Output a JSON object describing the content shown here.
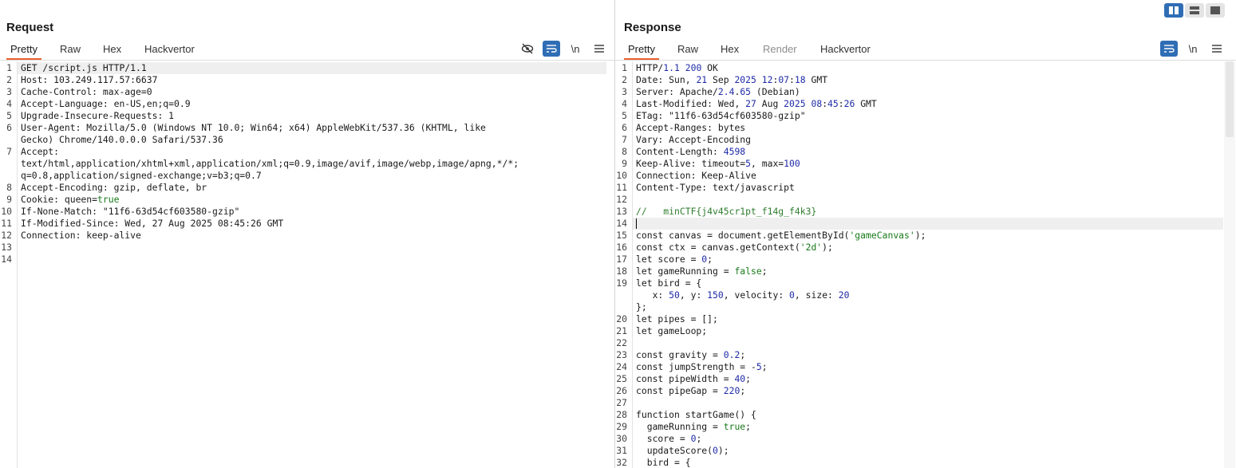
{
  "request": {
    "title": "Request",
    "tabs": [
      "Pretty",
      "Raw",
      "Hex",
      "Hackvertor"
    ],
    "active_tab": "Pretty",
    "icons": [
      "eye-off-icon",
      "wrap-icon",
      "newline-icon",
      "menu-icon"
    ],
    "newline_label": "\\n",
    "lines": [
      {
        "n": "1",
        "t": "GET /script.js HTTP/1.1"
      },
      {
        "n": "2",
        "t": "Host: 103.249.117.57:6637"
      },
      {
        "n": "3",
        "t": "Cache-Control: max-age=0"
      },
      {
        "n": "4",
        "t": "Accept-Language: en-US,en;q=0.9"
      },
      {
        "n": "5",
        "t": "Upgrade-Insecure-Requests: 1"
      },
      {
        "n": "6",
        "t": "User-Agent: Mozilla/5.0 (Windows NT 10.0; Win64; x64) AppleWebKit/537.36 (KHTML, like"
      },
      {
        "n": "",
        "t": "Gecko) Chrome/140.0.0.0 Safari/537.36"
      },
      {
        "n": "7",
        "t": "Accept:"
      },
      {
        "n": "",
        "t": "text/html,application/xhtml+xml,application/xml;q=0.9,image/avif,image/webp,image/apng,*/*;"
      },
      {
        "n": "",
        "t": "q=0.8,application/signed-exchange;v=b3;q=0.7"
      },
      {
        "n": "8",
        "t": "Accept-Encoding: gzip, deflate, br"
      },
      {
        "n": "9",
        "t": "Cookie: queen=true"
      },
      {
        "n": "10",
        "t": "If-None-Match: \"11f6-63d54cf603580-gzip\""
      },
      {
        "n": "11",
        "t": "If-Modified-Since: Wed, 27 Aug 2025 08:45:26 GMT"
      },
      {
        "n": "12",
        "t": "Connection: keep-alive"
      },
      {
        "n": "13",
        "t": ""
      },
      {
        "n": "14",
        "t": ""
      }
    ]
  },
  "response": {
    "title": "Response",
    "tabs": [
      "Pretty",
      "Raw",
      "Hex",
      "Render",
      "Hackvertor"
    ],
    "active_tab": "Pretty",
    "disabled_tab": "Render",
    "icons": [
      "wrap-icon",
      "newline-icon",
      "menu-icon"
    ],
    "newline_label": "\\n",
    "lines": [
      {
        "n": "1",
        "t": "HTTP/1.1 200 OK"
      },
      {
        "n": "2",
        "t": "Date: Sun, 21 Sep 2025 12:07:18 GMT"
      },
      {
        "n": "3",
        "t": "Server: Apache/2.4.65 (Debian)"
      },
      {
        "n": "4",
        "t": "Last-Modified: Wed, 27 Aug 2025 08:45:26 GMT"
      },
      {
        "n": "5",
        "t": "ETag: \"11f6-63d54cf603580-gzip\""
      },
      {
        "n": "6",
        "t": "Accept-Ranges: bytes"
      },
      {
        "n": "7",
        "t": "Vary: Accept-Encoding"
      },
      {
        "n": "8",
        "t": "Content-Length: 4598"
      },
      {
        "n": "9",
        "t": "Keep-Alive: timeout=5, max=100"
      },
      {
        "n": "10",
        "t": "Connection: Keep-Alive"
      },
      {
        "n": "11",
        "t": "Content-Type: text/javascript"
      },
      {
        "n": "12",
        "t": ""
      },
      {
        "n": "13",
        "t": "//   minCTF{j4v45cr1pt_f14g_f4k3}"
      },
      {
        "n": "14",
        "t": ""
      },
      {
        "n": "15",
        "t": "const canvas = document.getElementById('gameCanvas');"
      },
      {
        "n": "16",
        "t": "const ctx = canvas.getContext('2d');"
      },
      {
        "n": "17",
        "t": "let score = 0;"
      },
      {
        "n": "18",
        "t": "let gameRunning = false;"
      },
      {
        "n": "19",
        "t": "let bird = {"
      },
      {
        "n": "",
        "t": "   x: 50, y: 150, velocity: 0, size: 20"
      },
      {
        "n": "",
        "t": "};"
      },
      {
        "n": "20",
        "t": "let pipes = [];"
      },
      {
        "n": "21",
        "t": "let gameLoop;"
      },
      {
        "n": "22",
        "t": ""
      },
      {
        "n": "23",
        "t": "const gravity = 0.2;"
      },
      {
        "n": "24",
        "t": "const jumpStrength = -5;"
      },
      {
        "n": "25",
        "t": "const pipeWidth = 40;"
      },
      {
        "n": "26",
        "t": "const pipeGap = 220;"
      },
      {
        "n": "27",
        "t": ""
      },
      {
        "n": "28",
        "t": "function startGame() {"
      },
      {
        "n": "29",
        "t": "  gameRunning = true;"
      },
      {
        "n": "30",
        "t": "  score = 0;"
      },
      {
        "n": "31",
        "t": "  updateScore(0);"
      },
      {
        "n": "32",
        "t": "  bird = {"
      }
    ]
  },
  "layout_buttons": [
    "split-horizontal-icon",
    "split-vertical-icon",
    "single-pane-icon"
  ],
  "colors": {
    "accent": "#e8622e",
    "toggle_on": "#2f6db5",
    "string": "#187a1a",
    "number": "#1e2aa7"
  }
}
